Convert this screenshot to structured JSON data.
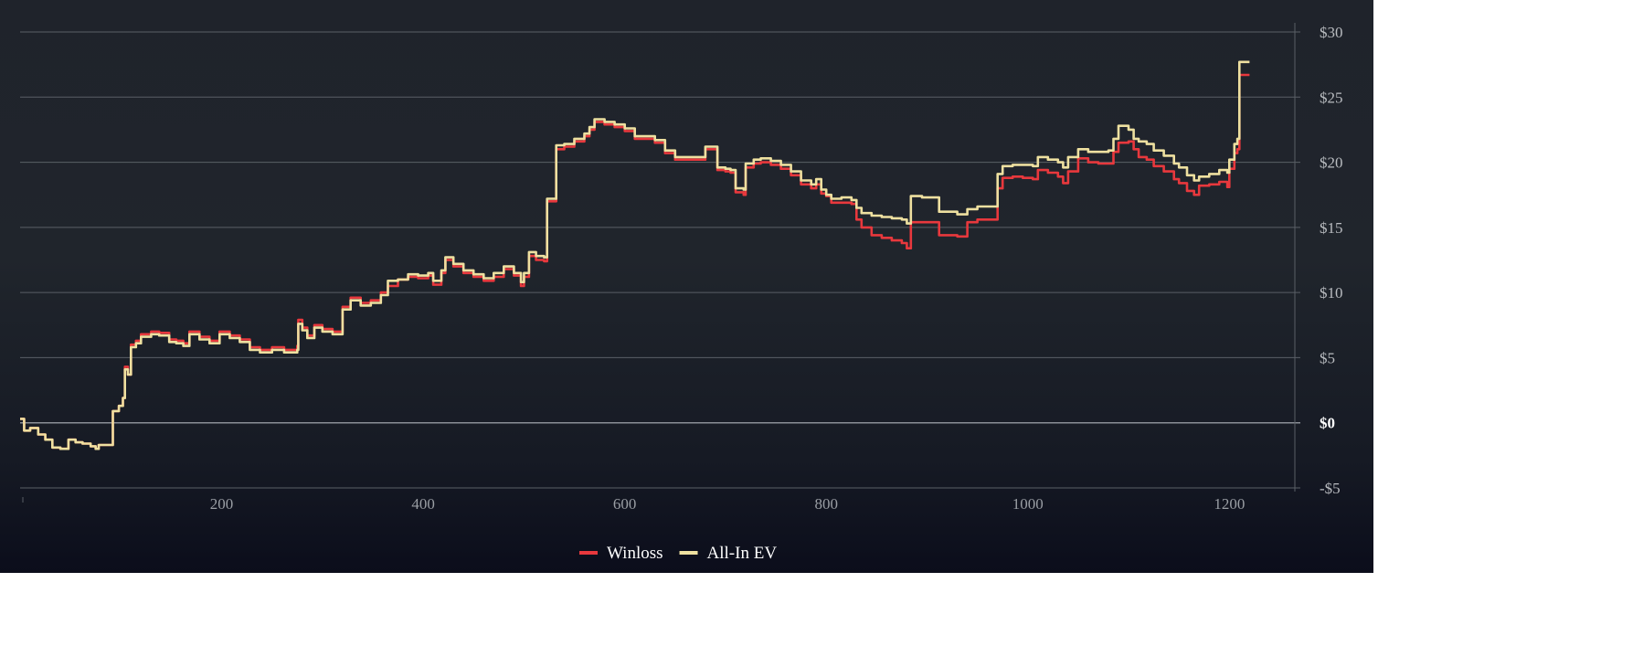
{
  "chart_data": {
    "type": "line",
    "title": "",
    "xlabel": "",
    "ylabel": "",
    "xlim": [
      0,
      1265
    ],
    "ylim": [
      -5,
      30
    ],
    "x_ticks": [
      200,
      400,
      600,
      800,
      1000,
      1200
    ],
    "x_tick_labels": [
      "200",
      "400",
      "600",
      "800",
      "1000",
      "1200"
    ],
    "y_ticks": [
      -5,
      0,
      5,
      10,
      15,
      20,
      25,
      30
    ],
    "y_tick_labels": [
      "-$5",
      "$0",
      "$5",
      "$10",
      "$15",
      "$20",
      "$25",
      "$30"
    ],
    "grid": true,
    "legend_position": "bottom-center",
    "series": [
      {
        "name": "Winloss",
        "color": "#e8383d",
        "points": [
          [
            0,
            0.3
          ],
          [
            4,
            -0.6
          ],
          [
            10,
            -0.4
          ],
          [
            18,
            -0.9
          ],
          [
            25,
            -1.3
          ],
          [
            32,
            -1.9
          ],
          [
            40,
            -2.0
          ],
          [
            48,
            -1.3
          ],
          [
            55,
            -1.5
          ],
          [
            62,
            -1.6
          ],
          [
            70,
            -1.8
          ],
          [
            75,
            -2.0
          ],
          [
            78,
            -1.7
          ],
          [
            90,
            -1.7
          ],
          [
            92,
            0.9
          ],
          [
            98,
            1.3
          ],
          [
            102,
            1.9
          ],
          [
            104,
            4.3
          ],
          [
            107,
            3.7
          ],
          [
            110,
            6.0
          ],
          [
            115,
            6.3
          ],
          [
            120,
            6.8
          ],
          [
            130,
            7.0
          ],
          [
            138,
            6.9
          ],
          [
            148,
            6.4
          ],
          [
            155,
            6.3
          ],
          [
            162,
            6.1
          ],
          [
            168,
            7.0
          ],
          [
            178,
            6.6
          ],
          [
            188,
            6.3
          ],
          [
            198,
            7.0
          ],
          [
            208,
            6.7
          ],
          [
            218,
            6.4
          ],
          [
            228,
            5.8
          ],
          [
            238,
            5.6
          ],
          [
            250,
            5.8
          ],
          [
            262,
            5.6
          ],
          [
            275,
            5.9
          ],
          [
            276,
            7.9
          ],
          [
            280,
            7.3
          ],
          [
            285,
            6.7
          ],
          [
            292,
            7.5
          ],
          [
            300,
            7.2
          ],
          [
            310,
            7.0
          ],
          [
            320,
            8.9
          ],
          [
            328,
            9.6
          ],
          [
            338,
            9.2
          ],
          [
            348,
            9.4
          ],
          [
            358,
            10.0
          ],
          [
            365,
            10.5
          ],
          [
            375,
            11.0
          ],
          [
            385,
            11.2
          ],
          [
            395,
            11.1
          ],
          [
            405,
            11.3
          ],
          [
            410,
            10.6
          ],
          [
            418,
            11.5
          ],
          [
            422,
            12.5
          ],
          [
            430,
            12.0
          ],
          [
            440,
            11.5
          ],
          [
            450,
            11.2
          ],
          [
            460,
            10.9
          ],
          [
            470,
            11.2
          ],
          [
            480,
            11.8
          ],
          [
            490,
            11.3
          ],
          [
            497,
            10.5
          ],
          [
            500,
            11.2
          ],
          [
            505,
            12.8
          ],
          [
            512,
            12.5
          ],
          [
            520,
            12.4
          ],
          [
            523,
            17.0
          ],
          [
            530,
            17.0
          ],
          [
            532,
            21.0
          ],
          [
            540,
            21.2
          ],
          [
            550,
            21.6
          ],
          [
            560,
            22.0
          ],
          [
            565,
            22.5
          ],
          [
            570,
            23.1
          ],
          [
            580,
            22.9
          ],
          [
            590,
            22.7
          ],
          [
            600,
            22.4
          ],
          [
            610,
            21.8
          ],
          [
            620,
            21.8
          ],
          [
            630,
            21.5
          ],
          [
            640,
            20.7
          ],
          [
            650,
            20.2
          ],
          [
            660,
            20.2
          ],
          [
            670,
            20.2
          ],
          [
            680,
            21.0
          ],
          [
            692,
            19.4
          ],
          [
            700,
            19.3
          ],
          [
            705,
            19.2
          ],
          [
            710,
            17.7
          ],
          [
            718,
            17.5
          ],
          [
            720,
            19.6
          ],
          [
            728,
            19.9
          ],
          [
            735,
            20.0
          ],
          [
            745,
            19.8
          ],
          [
            755,
            19.5
          ],
          [
            765,
            19.0
          ],
          [
            775,
            18.3
          ],
          [
            785,
            18.0
          ],
          [
            790,
            18.3
          ],
          [
            795,
            17.6
          ],
          [
            800,
            17.4
          ],
          [
            805,
            16.9
          ],
          [
            815,
            16.9
          ],
          [
            825,
            16.8
          ],
          [
            830,
            15.6
          ],
          [
            835,
            15.0
          ],
          [
            845,
            14.4
          ],
          [
            855,
            14.2
          ],
          [
            865,
            14.0
          ],
          [
            875,
            13.8
          ],
          [
            880,
            13.4
          ],
          [
            884,
            15.4
          ],
          [
            895,
            15.4
          ],
          [
            905,
            15.4
          ],
          [
            912,
            14.4
          ],
          [
            920,
            14.4
          ],
          [
            930,
            14.3
          ],
          [
            940,
            15.4
          ],
          [
            950,
            15.6
          ],
          [
            960,
            15.6
          ],
          [
            970,
            18.0
          ],
          [
            975,
            18.8
          ],
          [
            985,
            18.9
          ],
          [
            995,
            18.8
          ],
          [
            1005,
            18.7
          ],
          [
            1010,
            19.4
          ],
          [
            1020,
            19.2
          ],
          [
            1030,
            18.9
          ],
          [
            1035,
            18.4
          ],
          [
            1040,
            19.3
          ],
          [
            1050,
            20.3
          ],
          [
            1060,
            20.0
          ],
          [
            1070,
            19.9
          ],
          [
            1080,
            19.9
          ],
          [
            1085,
            20.8
          ],
          [
            1090,
            21.5
          ],
          [
            1100,
            21.6
          ],
          [
            1105,
            21.0
          ],
          [
            1110,
            20.4
          ],
          [
            1118,
            20.2
          ],
          [
            1125,
            19.7
          ],
          [
            1135,
            19.3
          ],
          [
            1145,
            18.7
          ],
          [
            1150,
            18.4
          ],
          [
            1158,
            17.8
          ],
          [
            1165,
            17.5
          ],
          [
            1170,
            18.2
          ],
          [
            1180,
            18.3
          ],
          [
            1190,
            18.5
          ],
          [
            1198,
            18.1
          ],
          [
            1200,
            19.5
          ],
          [
            1205,
            20.7
          ],
          [
            1208,
            21.0
          ],
          [
            1210,
            26.7
          ],
          [
            1220,
            26.7
          ]
        ]
      },
      {
        "name": "All-In EV",
        "color": "#eee0a0",
        "points": [
          [
            0,
            0.3
          ],
          [
            4,
            -0.6
          ],
          [
            10,
            -0.4
          ],
          [
            18,
            -0.9
          ],
          [
            25,
            -1.3
          ],
          [
            32,
            -1.9
          ],
          [
            40,
            -2.0
          ],
          [
            48,
            -1.3
          ],
          [
            55,
            -1.5
          ],
          [
            62,
            -1.6
          ],
          [
            70,
            -1.8
          ],
          [
            75,
            -2.0
          ],
          [
            78,
            -1.7
          ],
          [
            90,
            -1.7
          ],
          [
            92,
            0.9
          ],
          [
            98,
            1.3
          ],
          [
            102,
            1.9
          ],
          [
            104,
            4.1
          ],
          [
            107,
            3.7
          ],
          [
            110,
            5.8
          ],
          [
            115,
            6.1
          ],
          [
            120,
            6.6
          ],
          [
            130,
            6.8
          ],
          [
            138,
            6.7
          ],
          [
            148,
            6.2
          ],
          [
            155,
            6.1
          ],
          [
            162,
            5.9
          ],
          [
            168,
            6.8
          ],
          [
            178,
            6.4
          ],
          [
            188,
            6.1
          ],
          [
            198,
            6.8
          ],
          [
            208,
            6.5
          ],
          [
            218,
            6.2
          ],
          [
            228,
            5.6
          ],
          [
            238,
            5.4
          ],
          [
            250,
            5.6
          ],
          [
            262,
            5.4
          ],
          [
            275,
            5.6
          ],
          [
            276,
            7.6
          ],
          [
            280,
            7.1
          ],
          [
            285,
            6.5
          ],
          [
            292,
            7.3
          ],
          [
            300,
            7.0
          ],
          [
            310,
            6.8
          ],
          [
            320,
            8.7
          ],
          [
            328,
            9.4
          ],
          [
            338,
            9.0
          ],
          [
            348,
            9.2
          ],
          [
            358,
            9.8
          ],
          [
            365,
            10.9
          ],
          [
            375,
            11.0
          ],
          [
            385,
            11.4
          ],
          [
            395,
            11.3
          ],
          [
            405,
            11.5
          ],
          [
            410,
            10.9
          ],
          [
            418,
            11.7
          ],
          [
            422,
            12.7
          ],
          [
            430,
            12.2
          ],
          [
            440,
            11.7
          ],
          [
            450,
            11.4
          ],
          [
            460,
            11.1
          ],
          [
            470,
            11.5
          ],
          [
            480,
            12.0
          ],
          [
            490,
            11.5
          ],
          [
            497,
            10.8
          ],
          [
            500,
            11.5
          ],
          [
            505,
            13.1
          ],
          [
            512,
            12.8
          ],
          [
            520,
            12.7
          ],
          [
            523,
            17.2
          ],
          [
            530,
            17.2
          ],
          [
            532,
            21.3
          ],
          [
            540,
            21.4
          ],
          [
            550,
            21.8
          ],
          [
            560,
            22.2
          ],
          [
            565,
            22.7
          ],
          [
            570,
            23.3
          ],
          [
            580,
            23.1
          ],
          [
            590,
            22.9
          ],
          [
            600,
            22.6
          ],
          [
            610,
            22.0
          ],
          [
            620,
            22.0
          ],
          [
            630,
            21.7
          ],
          [
            640,
            20.9
          ],
          [
            650,
            20.4
          ],
          [
            660,
            20.4
          ],
          [
            670,
            20.4
          ],
          [
            680,
            21.2
          ],
          [
            692,
            19.6
          ],
          [
            700,
            19.5
          ],
          [
            705,
            19.4
          ],
          [
            710,
            18.0
          ],
          [
            718,
            17.9
          ],
          [
            720,
            19.9
          ],
          [
            728,
            20.2
          ],
          [
            735,
            20.3
          ],
          [
            745,
            20.1
          ],
          [
            755,
            19.8
          ],
          [
            765,
            19.3
          ],
          [
            775,
            18.6
          ],
          [
            785,
            18.3
          ],
          [
            790,
            18.7
          ],
          [
            795,
            17.9
          ],
          [
            800,
            17.5
          ],
          [
            805,
            17.2
          ],
          [
            815,
            17.3
          ],
          [
            825,
            17.1
          ],
          [
            830,
            16.5
          ],
          [
            835,
            16.1
          ],
          [
            845,
            15.9
          ],
          [
            855,
            15.8
          ],
          [
            865,
            15.7
          ],
          [
            875,
            15.6
          ],
          [
            880,
            15.3
          ],
          [
            884,
            17.4
          ],
          [
            895,
            17.3
          ],
          [
            905,
            17.3
          ],
          [
            912,
            16.2
          ],
          [
            920,
            16.2
          ],
          [
            930,
            16.0
          ],
          [
            940,
            16.4
          ],
          [
            950,
            16.6
          ],
          [
            960,
            16.6
          ],
          [
            970,
            19.1
          ],
          [
            975,
            19.7
          ],
          [
            985,
            19.8
          ],
          [
            995,
            19.8
          ],
          [
            1005,
            19.7
          ],
          [
            1010,
            20.4
          ],
          [
            1020,
            20.2
          ],
          [
            1030,
            20.0
          ],
          [
            1035,
            19.6
          ],
          [
            1040,
            20.4
          ],
          [
            1050,
            21.0
          ],
          [
            1060,
            20.8
          ],
          [
            1070,
            20.8
          ],
          [
            1080,
            20.9
          ],
          [
            1085,
            21.8
          ],
          [
            1090,
            22.8
          ],
          [
            1100,
            22.5
          ],
          [
            1105,
            21.8
          ],
          [
            1110,
            21.6
          ],
          [
            1118,
            21.4
          ],
          [
            1125,
            20.9
          ],
          [
            1135,
            20.5
          ],
          [
            1145,
            19.9
          ],
          [
            1150,
            19.6
          ],
          [
            1158,
            19.0
          ],
          [
            1165,
            18.6
          ],
          [
            1170,
            18.9
          ],
          [
            1180,
            19.1
          ],
          [
            1190,
            19.4
          ],
          [
            1198,
            19.2
          ],
          [
            1200,
            20.2
          ],
          [
            1205,
            21.4
          ],
          [
            1208,
            21.8
          ],
          [
            1210,
            27.7
          ],
          [
            1220,
            27.7
          ]
        ]
      }
    ]
  }
}
